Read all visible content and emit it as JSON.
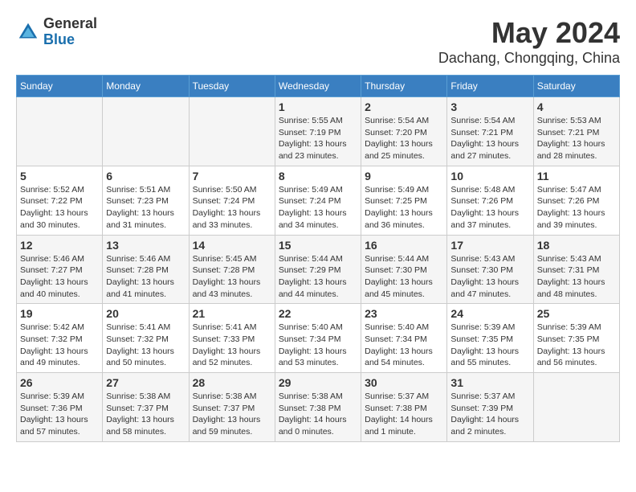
{
  "header": {
    "logo_general": "General",
    "logo_blue": "Blue",
    "title": "May 2024",
    "location": "Dachang, Chongqing, China"
  },
  "weekdays": [
    "Sunday",
    "Monday",
    "Tuesday",
    "Wednesday",
    "Thursday",
    "Friday",
    "Saturday"
  ],
  "weeks": [
    [
      {
        "day": "",
        "info": ""
      },
      {
        "day": "",
        "info": ""
      },
      {
        "day": "",
        "info": ""
      },
      {
        "day": "1",
        "info": "Sunrise: 5:55 AM\nSunset: 7:19 PM\nDaylight: 13 hours\nand 23 minutes."
      },
      {
        "day": "2",
        "info": "Sunrise: 5:54 AM\nSunset: 7:20 PM\nDaylight: 13 hours\nand 25 minutes."
      },
      {
        "day": "3",
        "info": "Sunrise: 5:54 AM\nSunset: 7:21 PM\nDaylight: 13 hours\nand 27 minutes."
      },
      {
        "day": "4",
        "info": "Sunrise: 5:53 AM\nSunset: 7:21 PM\nDaylight: 13 hours\nand 28 minutes."
      }
    ],
    [
      {
        "day": "5",
        "info": "Sunrise: 5:52 AM\nSunset: 7:22 PM\nDaylight: 13 hours\nand 30 minutes."
      },
      {
        "day": "6",
        "info": "Sunrise: 5:51 AM\nSunset: 7:23 PM\nDaylight: 13 hours\nand 31 minutes."
      },
      {
        "day": "7",
        "info": "Sunrise: 5:50 AM\nSunset: 7:24 PM\nDaylight: 13 hours\nand 33 minutes."
      },
      {
        "day": "8",
        "info": "Sunrise: 5:49 AM\nSunset: 7:24 PM\nDaylight: 13 hours\nand 34 minutes."
      },
      {
        "day": "9",
        "info": "Sunrise: 5:49 AM\nSunset: 7:25 PM\nDaylight: 13 hours\nand 36 minutes."
      },
      {
        "day": "10",
        "info": "Sunrise: 5:48 AM\nSunset: 7:26 PM\nDaylight: 13 hours\nand 37 minutes."
      },
      {
        "day": "11",
        "info": "Sunrise: 5:47 AM\nSunset: 7:26 PM\nDaylight: 13 hours\nand 39 minutes."
      }
    ],
    [
      {
        "day": "12",
        "info": "Sunrise: 5:46 AM\nSunset: 7:27 PM\nDaylight: 13 hours\nand 40 minutes."
      },
      {
        "day": "13",
        "info": "Sunrise: 5:46 AM\nSunset: 7:28 PM\nDaylight: 13 hours\nand 41 minutes."
      },
      {
        "day": "14",
        "info": "Sunrise: 5:45 AM\nSunset: 7:28 PM\nDaylight: 13 hours\nand 43 minutes."
      },
      {
        "day": "15",
        "info": "Sunrise: 5:44 AM\nSunset: 7:29 PM\nDaylight: 13 hours\nand 44 minutes."
      },
      {
        "day": "16",
        "info": "Sunrise: 5:44 AM\nSunset: 7:30 PM\nDaylight: 13 hours\nand 45 minutes."
      },
      {
        "day": "17",
        "info": "Sunrise: 5:43 AM\nSunset: 7:30 PM\nDaylight: 13 hours\nand 47 minutes."
      },
      {
        "day": "18",
        "info": "Sunrise: 5:43 AM\nSunset: 7:31 PM\nDaylight: 13 hours\nand 48 minutes."
      }
    ],
    [
      {
        "day": "19",
        "info": "Sunrise: 5:42 AM\nSunset: 7:32 PM\nDaylight: 13 hours\nand 49 minutes."
      },
      {
        "day": "20",
        "info": "Sunrise: 5:41 AM\nSunset: 7:32 PM\nDaylight: 13 hours\nand 50 minutes."
      },
      {
        "day": "21",
        "info": "Sunrise: 5:41 AM\nSunset: 7:33 PM\nDaylight: 13 hours\nand 52 minutes."
      },
      {
        "day": "22",
        "info": "Sunrise: 5:40 AM\nSunset: 7:34 PM\nDaylight: 13 hours\nand 53 minutes."
      },
      {
        "day": "23",
        "info": "Sunrise: 5:40 AM\nSunset: 7:34 PM\nDaylight: 13 hours\nand 54 minutes."
      },
      {
        "day": "24",
        "info": "Sunrise: 5:39 AM\nSunset: 7:35 PM\nDaylight: 13 hours\nand 55 minutes."
      },
      {
        "day": "25",
        "info": "Sunrise: 5:39 AM\nSunset: 7:35 PM\nDaylight: 13 hours\nand 56 minutes."
      }
    ],
    [
      {
        "day": "26",
        "info": "Sunrise: 5:39 AM\nSunset: 7:36 PM\nDaylight: 13 hours\nand 57 minutes."
      },
      {
        "day": "27",
        "info": "Sunrise: 5:38 AM\nSunset: 7:37 PM\nDaylight: 13 hours\nand 58 minutes."
      },
      {
        "day": "28",
        "info": "Sunrise: 5:38 AM\nSunset: 7:37 PM\nDaylight: 13 hours\nand 59 minutes."
      },
      {
        "day": "29",
        "info": "Sunrise: 5:38 AM\nSunset: 7:38 PM\nDaylight: 14 hours\nand 0 minutes."
      },
      {
        "day": "30",
        "info": "Sunrise: 5:37 AM\nSunset: 7:38 PM\nDaylight: 14 hours\nand 1 minute."
      },
      {
        "day": "31",
        "info": "Sunrise: 5:37 AM\nSunset: 7:39 PM\nDaylight: 14 hours\nand 2 minutes."
      },
      {
        "day": "",
        "info": ""
      }
    ]
  ]
}
